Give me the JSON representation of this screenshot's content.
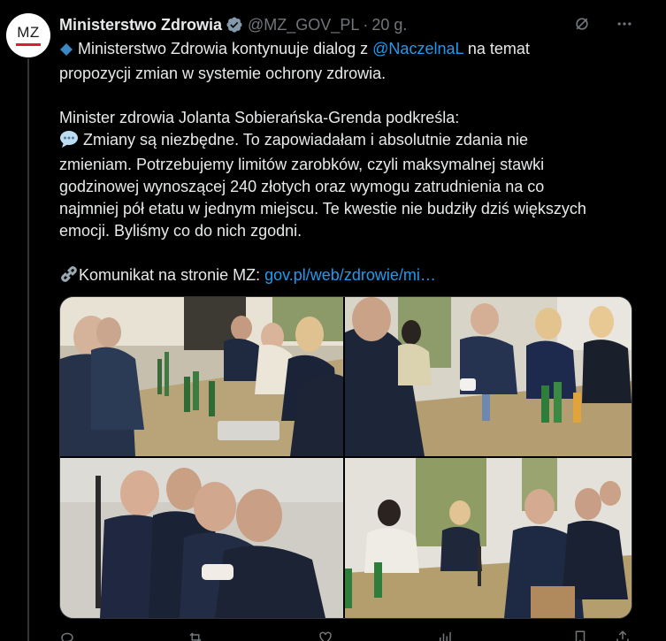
{
  "author": {
    "avatar_text": "MZ",
    "display_name": "Ministerstwo Zdrowia",
    "handle": "@MZ_GOV_PL",
    "separator": "·",
    "time": "20 g."
  },
  "icons": {
    "verified": "verified-badge-icon",
    "grok": "grok-icon",
    "more": "more-dots-icon",
    "diamond": "blue-diamond-emoji",
    "speech": "speech-balloon-emoji",
    "link": "link-emoji"
  },
  "body": {
    "line1_prefix": " Ministerstwo Zdrowia kontynuuje dialog z ",
    "mention": "@NaczelnaL",
    "line1_suffix": "  na temat",
    "line2": "propozycji zmian w systemie ochrony zdrowia.",
    "quote_intro": "Minister zdrowia Jolanta Sobierańska-Grenda podkreśla:",
    "quote_line1": " Zmiany są niezbędne. To zapowiadałam i absolutnie zdania nie",
    "quote_line2": "zmieniam. Potrzebujemy limitów zarobków, czyli maksymalnej stawki",
    "quote_line3": "godzinowej wynoszącej 240 złotych oraz wymogu zatrudnienia na co",
    "quote_line4": "najmniej pół etatu w jednym miejscu. Te kwestie nie budziły dziś większych",
    "quote_line5": "emocji. Byliśmy co do nich zgodni.",
    "link_label": "Komunikat na stronie MZ: ",
    "link_text": "gov.pl/web/zdrowie/mi…"
  },
  "photos": [
    {
      "name": "photo-meeting-1"
    },
    {
      "name": "photo-meeting-2"
    },
    {
      "name": "photo-meeting-3"
    },
    {
      "name": "photo-meeting-4"
    }
  ],
  "colors": {
    "background": "#000000",
    "text": "#e7e9ea",
    "secondary": "#71767b",
    "accent": "#1d9bf0",
    "verified": "#829aab",
    "avatar_bar": "#dc1e35"
  }
}
